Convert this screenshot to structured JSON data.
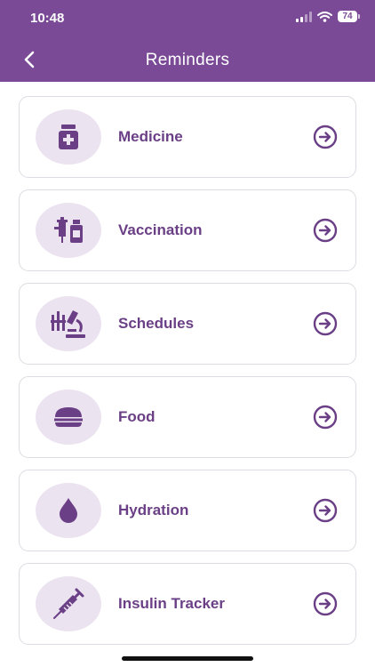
{
  "status_bar": {
    "time": "10:48",
    "battery": "74"
  },
  "header": {
    "title": "Reminders"
  },
  "reminders": [
    {
      "label": "Medicine",
      "icon": "medicine-bottle-icon"
    },
    {
      "label": "Vaccination",
      "icon": "vaccination-icon"
    },
    {
      "label": "Schedules",
      "icon": "microscope-icon"
    },
    {
      "label": "Food",
      "icon": "food-burger-icon"
    },
    {
      "label": "Hydration",
      "icon": "water-drop-icon"
    },
    {
      "label": "Insulin Tracker",
      "icon": "syringe-icon"
    }
  ],
  "colors": {
    "header_bg": "#7a4a96",
    "accent": "#6b3f86",
    "icon_bg": "#ece3f1",
    "card_border": "#dedbe2"
  }
}
